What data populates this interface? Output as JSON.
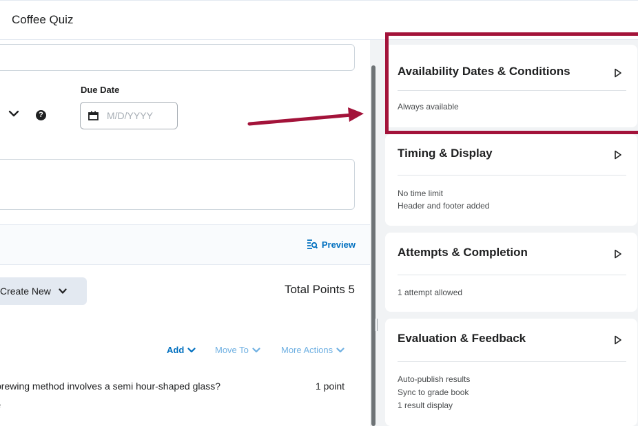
{
  "header": {
    "title": "Coffee Quiz"
  },
  "form": {
    "due_date_label": "Due Date",
    "due_date_placeholder": "M/D/YYYY",
    "help_glyph": "?"
  },
  "toolbar": {
    "preview_label": "Preview",
    "create_new_label": "Create New",
    "total_points": "Total Points 5"
  },
  "question_actions": {
    "add_label": "Add",
    "move_to_label": "Move To",
    "more_actions_label": "More Actions"
  },
  "question": {
    "text": "brewing method involves a semi hour-shaped glass?",
    "points": "1 point",
    "sub": "e"
  },
  "sidebar": {
    "cards": [
      {
        "title": "Availability Dates & Conditions",
        "lines": [
          "Always available"
        ]
      },
      {
        "title": "Timing & Display",
        "lines": [
          "No time limit",
          "Header and footer added"
        ]
      },
      {
        "title": "Attempts & Completion",
        "lines": [
          "1 attempt allowed"
        ]
      },
      {
        "title": "Evaluation & Feedback",
        "lines": [
          "Auto-publish results",
          "Sync to grade book",
          "1 result display"
        ]
      }
    ]
  },
  "colors": {
    "accent": "#006fbf",
    "highlight": "#a3133a",
    "panel_bg": "#f1f3f5"
  },
  "icons": [
    "chevron-down-icon",
    "help-icon",
    "calendar-icon",
    "preview-icon",
    "play-arrow-icon"
  ]
}
